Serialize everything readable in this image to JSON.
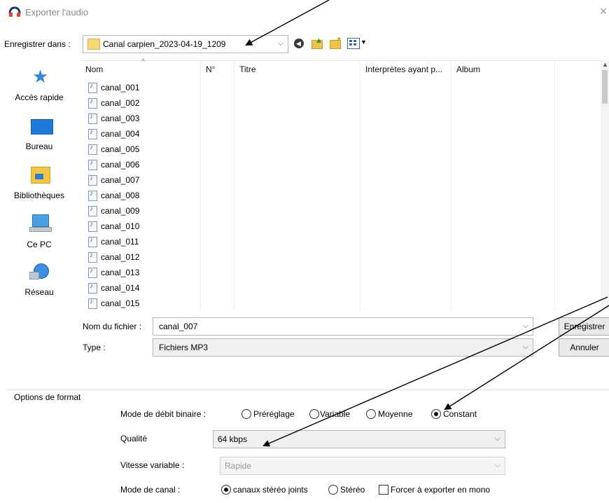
{
  "window": {
    "title": "Exporter l'audio",
    "close_glyph": "✕"
  },
  "location": {
    "label": "Enregistrer dans :",
    "current": "Canal carpien_2023-04-19_1209"
  },
  "sidebar": {
    "items": [
      {
        "label": "Accès rapide",
        "icon": "star-icon"
      },
      {
        "label": "Bureau",
        "icon": "desktop-icon"
      },
      {
        "label": "Bibliothèques",
        "icon": "library-icon"
      },
      {
        "label": "Ce PC",
        "icon": "computer-icon"
      },
      {
        "label": "Réseau",
        "icon": "network-icon"
      }
    ]
  },
  "filelist": {
    "columns": [
      "Nom",
      "N°",
      "Titre",
      "Interprètes ayant p...",
      "Album"
    ],
    "files": [
      "canal_001",
      "canal_002",
      "canal_003",
      "canal_004",
      "canal_005",
      "canal_006",
      "canal_007",
      "canal_008",
      "canal_009",
      "canal_010",
      "canal_011",
      "canal_012",
      "canal_013",
      "canal_014",
      "canal_015"
    ]
  },
  "filename": {
    "label": "Nom du fichier :",
    "value": "canal_007"
  },
  "filetype": {
    "label": "Type :",
    "value": "Fichiers MP3"
  },
  "buttons": {
    "save": "Enregistrer",
    "cancel": "Annuler"
  },
  "options": {
    "section_title": "Options de format",
    "bitrate_mode": {
      "label": "Mode de débit binaire :",
      "choices": [
        "Préréglage",
        "Variable",
        "Moyenne",
        "Constant"
      ],
      "selected": "Constant"
    },
    "quality": {
      "label": "Qualité",
      "value": "64 kbps"
    },
    "variable_speed": {
      "label": "Vitesse variable :",
      "value": "Rapide"
    },
    "channel_mode": {
      "label": "Mode de canal :",
      "choices": [
        "canaux stéréo joints",
        "Stéréo"
      ],
      "selected": "canaux stéréo joints",
      "force_mono_label": "Forcer à exporter en mono",
      "force_mono": false
    }
  },
  "colors": {
    "accent": "#1f5fb5",
    "folder": "#f7d774"
  }
}
